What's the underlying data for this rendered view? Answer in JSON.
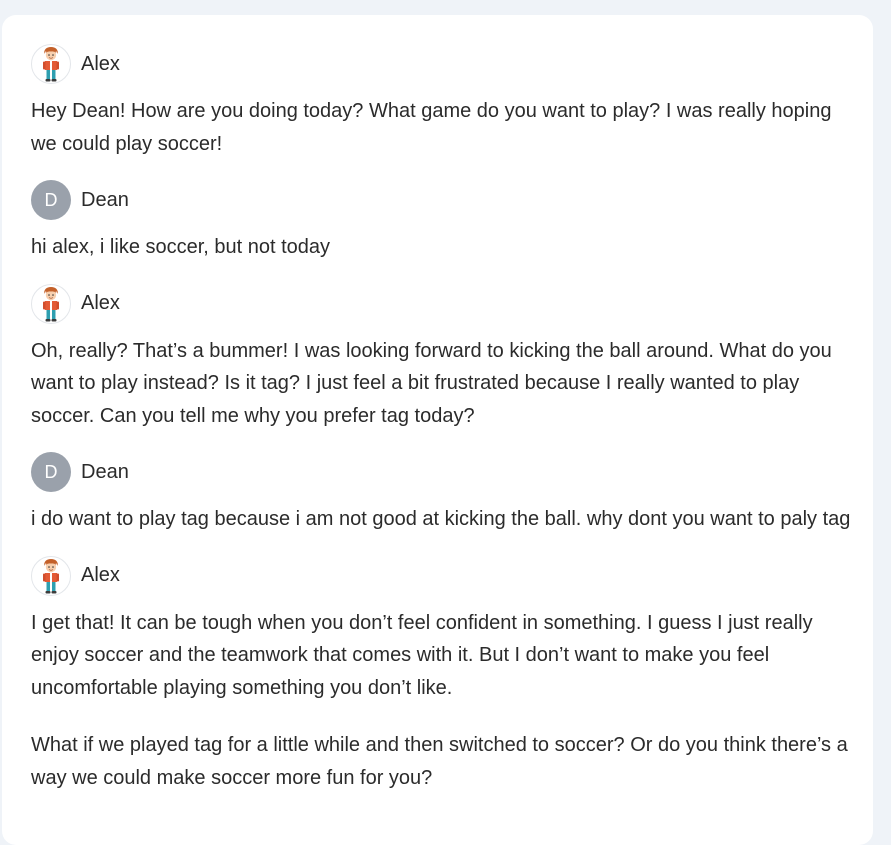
{
  "messages": [
    {
      "speaker": "Alex",
      "avatar": {
        "type": "image",
        "icon": "boy-cartoon-icon"
      },
      "paragraphs": [
        "Hey Dean! How are you doing today? What game do you want to play? I was really hoping we could play soccer!"
      ]
    },
    {
      "speaker": "Dean",
      "avatar": {
        "type": "initial",
        "initial": "D",
        "color": "#9aa1ab"
      },
      "paragraphs": [
        "hi alex, i like soccer, but not today"
      ]
    },
    {
      "speaker": "Alex",
      "avatar": {
        "type": "image",
        "icon": "boy-cartoon-icon"
      },
      "paragraphs": [
        "Oh, really? That’s a bummer! I was looking forward to kicking the ball around. What do you want to play instead? Is it tag? I just feel a bit frustrated because I really wanted to play soccer. Can you tell me why you prefer tag today?"
      ]
    },
    {
      "speaker": "Dean",
      "avatar": {
        "type": "initial",
        "initial": "D",
        "color": "#9aa1ab"
      },
      "paragraphs": [
        "i do want to play tag because i am not good at kicking the ball. why dont you want to paly tag"
      ]
    },
    {
      "speaker": "Alex",
      "avatar": {
        "type": "image",
        "icon": "boy-cartoon-icon"
      },
      "paragraphs": [
        "I get that! It can be tough when you don’t feel confident in something. I guess I just really enjoy soccer and the teamwork that comes with it. But I don’t want to make you feel uncomfortable playing something you don’t like.",
        "What if we played tag for a little while and then switched to soccer? Or do you think there’s a way we could make soccer more fun for you?"
      ]
    }
  ],
  "colors": {
    "page_background": "#eff3f8",
    "card_background": "#ffffff",
    "text": "#2b2b2b",
    "dean_avatar": "#9aa1ab"
  }
}
